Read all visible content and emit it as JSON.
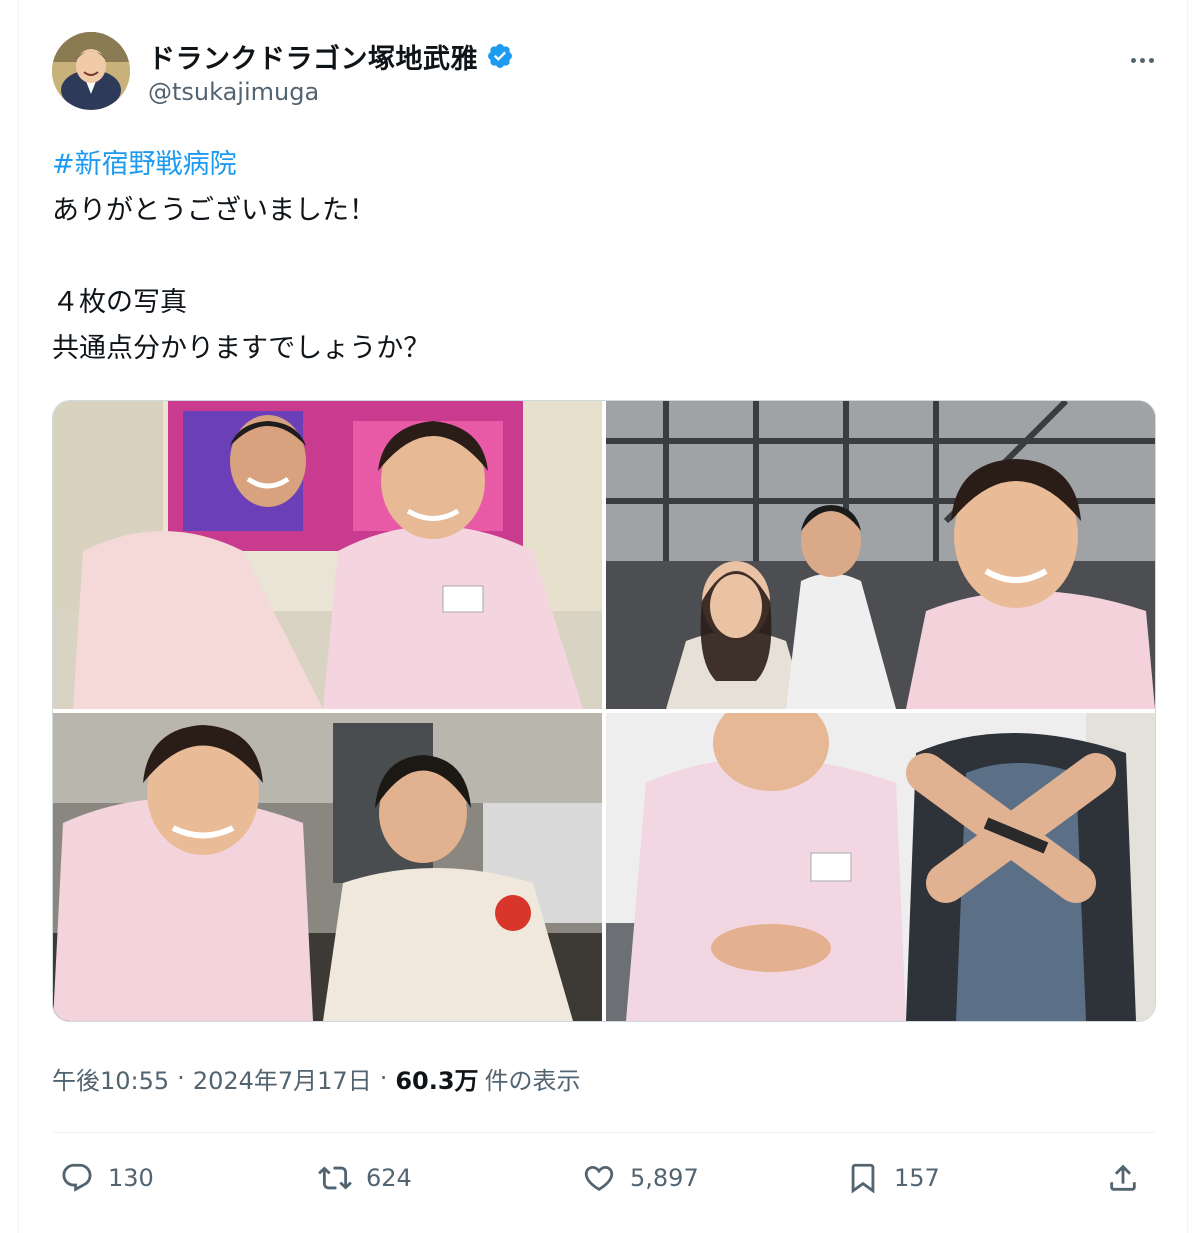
{
  "author": {
    "display_name": "ドランクドラゴン塚地武雅",
    "handle": "@tsukajimuga",
    "verified": true
  },
  "tweet": {
    "hashtag": "#新宿野戦病院",
    "lines": [
      "ありがとうございました！",
      "４枚の写真",
      "共通点分かりますでしょうか？"
    ]
  },
  "media": {
    "photo_count": 4
  },
  "meta": {
    "time": "午後10:55",
    "date": "2024年7月17日",
    "views": "60.3万",
    "views_label": "件の表示"
  },
  "actions": {
    "replies": "130",
    "retweets": "624",
    "likes": "5,897",
    "bookmarks": "157"
  },
  "colors": {
    "accent": "#1d9bf0",
    "secondary_text": "#536471",
    "border": "#cfd9de"
  }
}
